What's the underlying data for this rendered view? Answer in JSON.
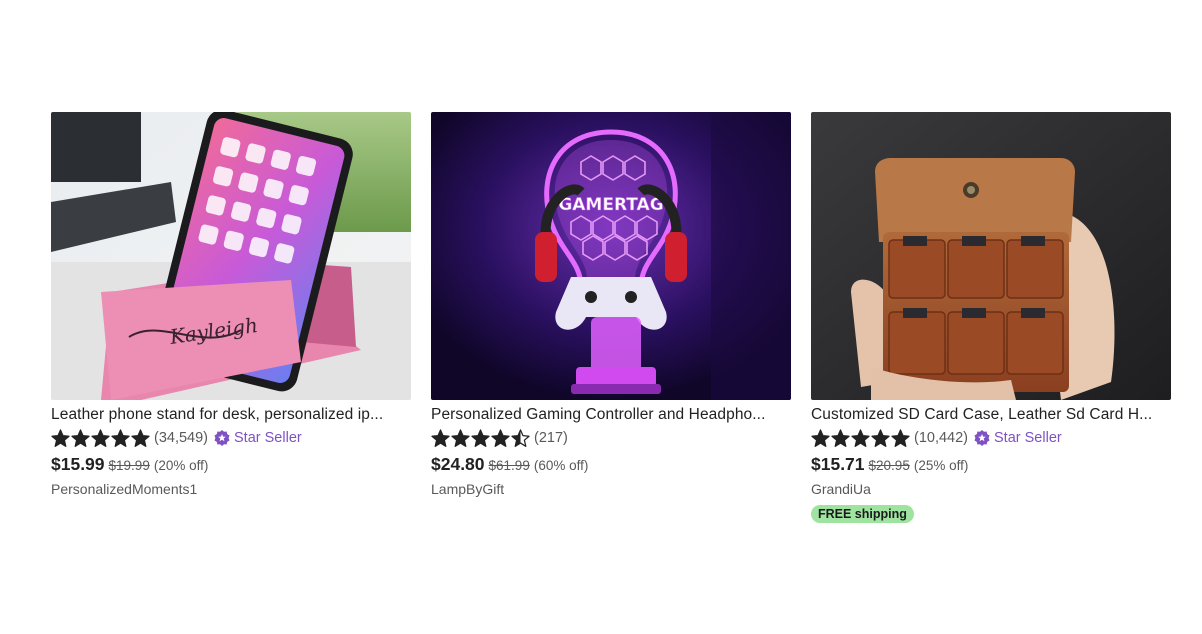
{
  "listings": [
    {
      "title": "Leather phone stand for desk, personalized ip...",
      "review_count": "(34,549)",
      "star_seller_label": "Star Seller",
      "price": "$15.99",
      "original_price": "$19.99",
      "discount": "(20% off)",
      "shop": "PersonalizedMoments1",
      "rating": 5,
      "image_text": "Kayleigh"
    },
    {
      "title": "Personalized Gaming Controller and Headpho...",
      "review_count": "(217)",
      "price": "$24.80",
      "original_price": "$61.99",
      "discount": "(60% off)",
      "shop": "LampByGift",
      "rating": 4.5,
      "image_text": "GAMERTAG"
    },
    {
      "title": "Customized SD Card Case, Leather Sd Card H...",
      "review_count": "(10,442)",
      "star_seller_label": "Star Seller",
      "price": "$15.71",
      "original_price": "$20.95",
      "discount": "(25% off)",
      "shop": "GrandiUa",
      "rating": 5,
      "shipping_badge": "FREE shipping"
    }
  ],
  "colors": {
    "star": "#222222",
    "star_seller": "#7f52c4",
    "free_shipping_bg": "#9ee3a0",
    "muted_text": "#595959"
  },
  "icons": {
    "rating": "star-icon",
    "star_seller": "star-seller-badge-icon"
  }
}
